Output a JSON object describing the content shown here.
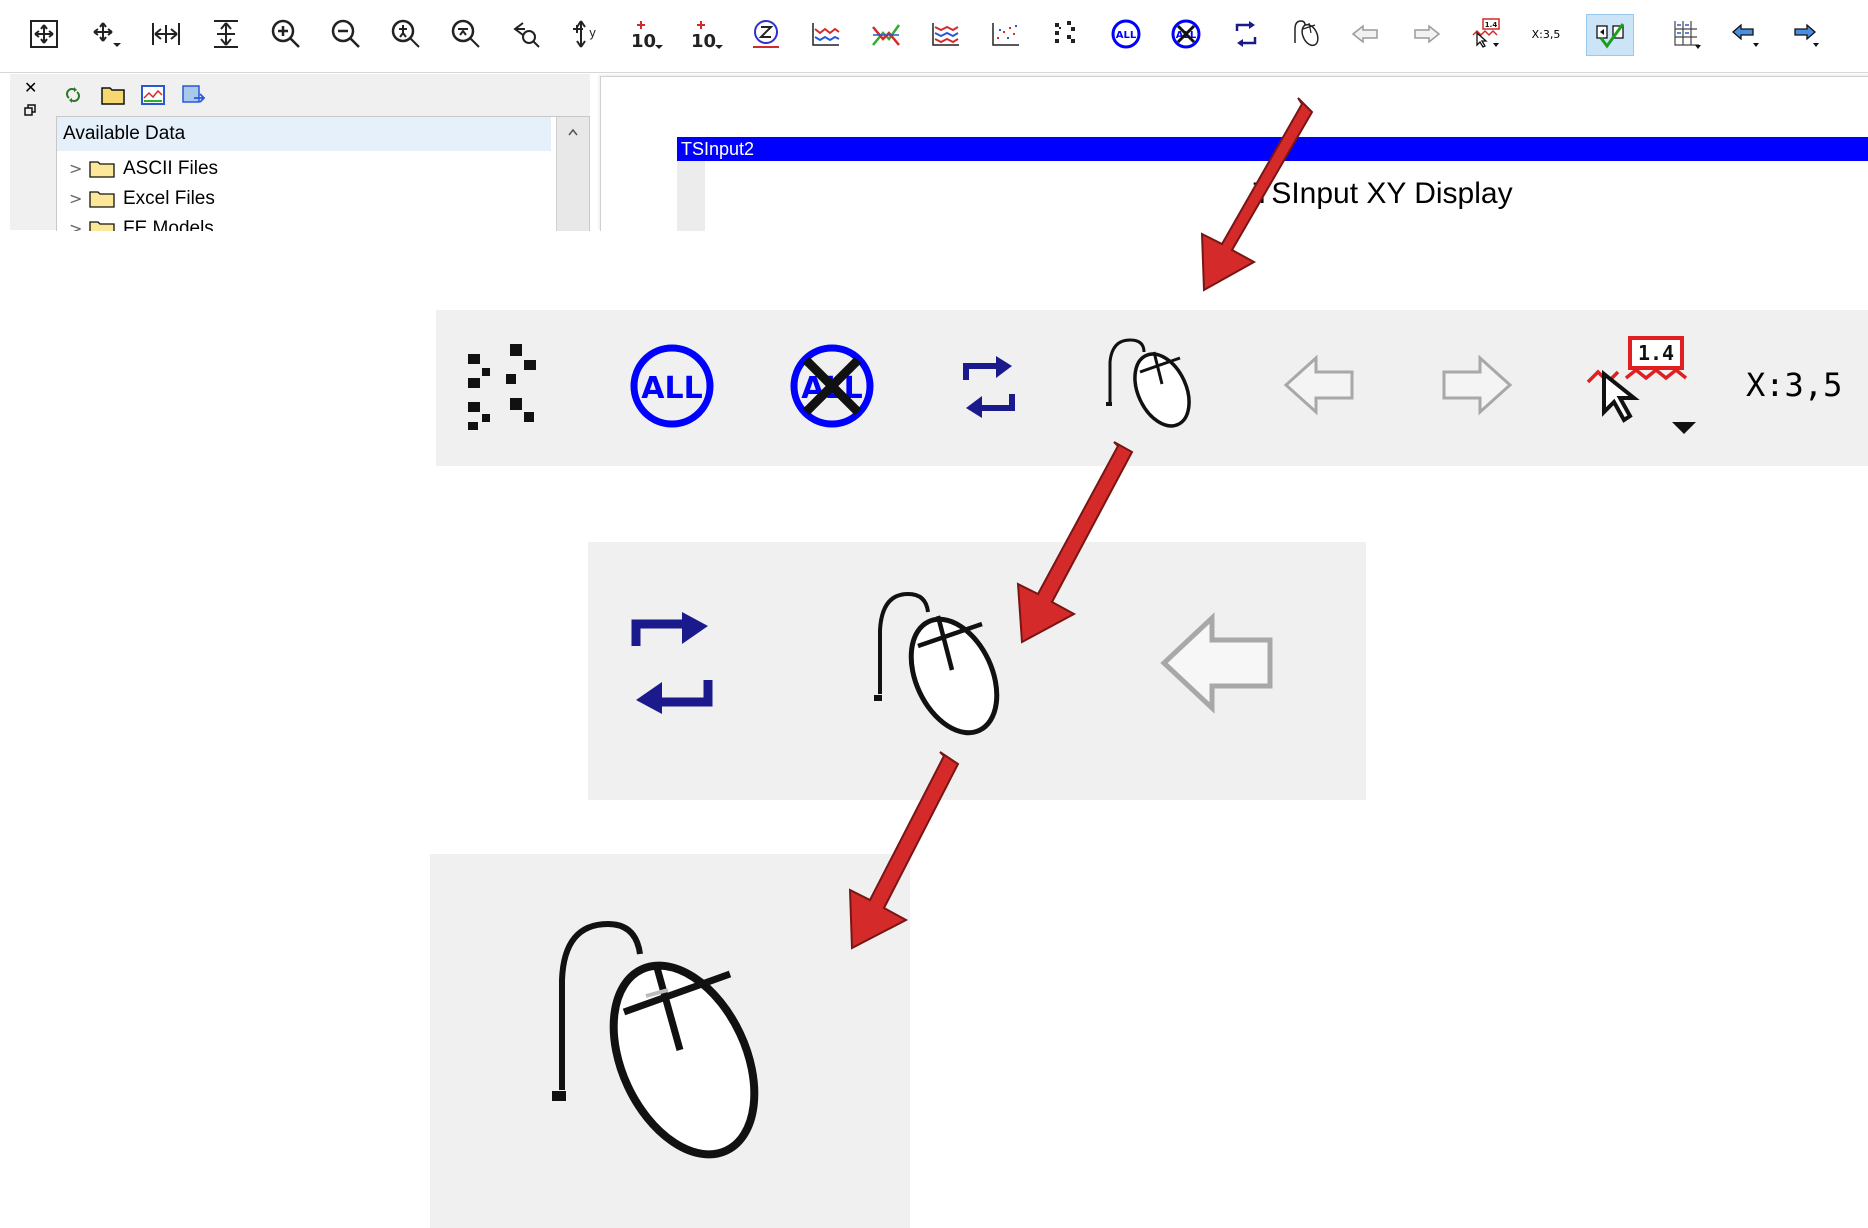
{
  "toolbar": {
    "buttons": [
      {
        "name": "pan-all-icon"
      },
      {
        "name": "pan-icon"
      },
      {
        "name": "zoom-x-extent-icon"
      },
      {
        "name": "zoom-y-extent-icon"
      },
      {
        "name": "zoom-in-icon"
      },
      {
        "name": "zoom-out-icon"
      },
      {
        "name": "zoom-in-y-icon"
      },
      {
        "name": "zoom-out-y-icon"
      },
      {
        "name": "zoom-back-icon"
      },
      {
        "name": "y-axis-icon"
      },
      {
        "name": "log-x-icon"
      },
      {
        "name": "log-y-icon"
      },
      {
        "name": "zoom-z-icon"
      },
      {
        "name": "line-chart-icon"
      },
      {
        "name": "multi-line-chart-icon"
      },
      {
        "name": "stacked-line-chart-icon"
      },
      {
        "name": "scatter-chart-icon"
      },
      {
        "name": "points-icon"
      },
      {
        "name": "select-all-icon"
      },
      {
        "name": "deselect-all-icon"
      },
      {
        "name": "refresh-icon"
      },
      {
        "name": "mouse-icon"
      },
      {
        "name": "back-arrow-icon"
      },
      {
        "name": "forward-arrow-icon"
      },
      {
        "name": "value-tooltip-icon"
      },
      {
        "name": "coordinates-icon"
      },
      {
        "name": "toggle-check-icon"
      },
      {
        "name": "table-icon"
      },
      {
        "name": "back-blue-arrow-icon"
      },
      {
        "name": "forward-blue-arrow-icon"
      }
    ],
    "tooltip_value": "1.4",
    "coords_text": "X:3,5",
    "all_text": "ALL",
    "log_base": "10"
  },
  "left_panel": {
    "close_glyph": "✕",
    "header": "Available Data",
    "tree_items": [
      {
        "label": "ASCII Files"
      },
      {
        "label": "Excel Files"
      },
      {
        "label": "FE Models"
      }
    ]
  },
  "main": {
    "window_title": "TSInput2",
    "display_title": "TSInput XY Display"
  },
  "zoom1": {
    "all_text": "ALL",
    "tooltip_value": "1.4",
    "coords_text": "X:3,5"
  },
  "colors": {
    "accent_blue": "#0000ff",
    "arrow_red": "#d42a2a",
    "selection_bg": "#cce4f7",
    "tree_header_bg": "#e5f0fb"
  }
}
